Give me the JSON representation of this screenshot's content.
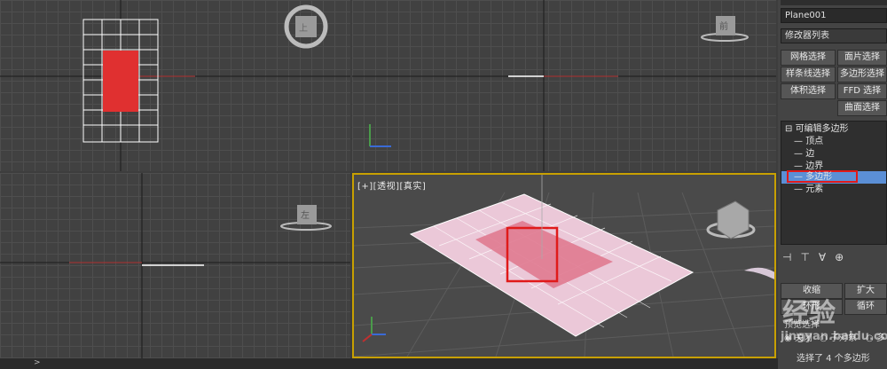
{
  "viewports": {
    "perspective_label": "[+][透视][真实]"
  },
  "view_cubes": {
    "top": "上",
    "front": "前",
    "left": "左"
  },
  "panel": {
    "object_name": "Plane001",
    "modifier_list": "修改器列表",
    "buttons": [
      "网格选择",
      "面片选择",
      "样条线选择",
      "多边形选择",
      "体积选择",
      "FFD 选择",
      "曲面选择"
    ],
    "stack_root": "可编辑多边形",
    "stack_items": [
      "顶点",
      "边",
      "边界",
      "多边形",
      "元素"
    ],
    "selected_item_index": 3,
    "shrink": "收缩",
    "grow": "扩大",
    "ring": "环形",
    "loop": "循环",
    "preview_selection": "预览选择",
    "off": "关闭",
    "sub_object": "子对象",
    "multi": "多",
    "selection_status": "选择了 4 个多边形"
  },
  "watermark": {
    "text": "经验",
    "sub": "jingyan.baidu.com"
  },
  "colors": {
    "accent_selection": "#e03030",
    "stack_highlight": "#5b8fd6",
    "active_border": "#c8a000"
  }
}
